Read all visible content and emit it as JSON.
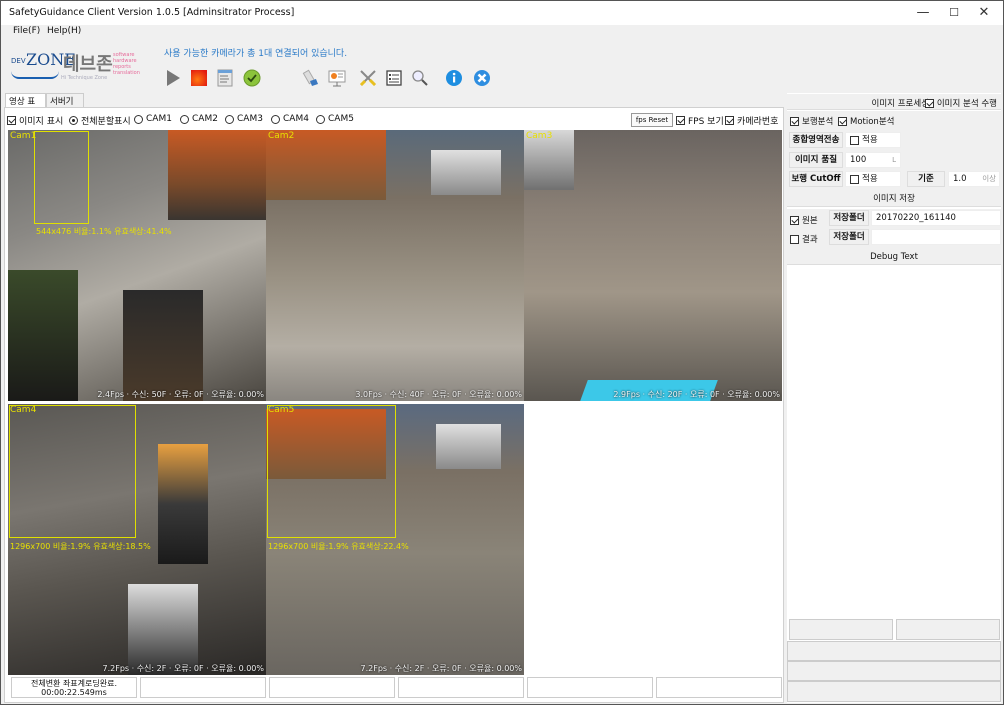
{
  "window": {
    "title": "SafetyGuidance Client Version 1.0.5 [Adminsitrator Process]",
    "minimize_glyph": "—",
    "maximize_glyph": "☐",
    "close_glyph": "✕"
  },
  "menu": {
    "file": "File(F)",
    "help": "Help(H)"
  },
  "logo": {
    "dev": "DEV",
    "zone": "ZONE",
    "korean": "데브존",
    "tagline": "Hi Technique Zone",
    "words": [
      "software",
      "hardware",
      "reports",
      "translation"
    ]
  },
  "notice": "사용 가능한 카메라가 총 1대 연결되어 있습니다.",
  "toolbar": {
    "icons": [
      "play-icon",
      "stop-icon",
      "document-list-icon",
      "checkmark-icon",
      "network-settings-icon",
      "presentation-chart-icon",
      "tools-icon",
      "form-list-icon",
      "search-icon",
      "info-icon",
      "close-circle-icon"
    ]
  },
  "tabs": [
    {
      "label": "영상 표시",
      "active": true
    },
    {
      "label": "서버기능",
      "active": false
    }
  ],
  "options": {
    "show_image": {
      "label": "이미지 표시",
      "checked": true
    },
    "view_mode": {
      "options": [
        "전체분할표시",
        "CAM1",
        "CAM2",
        "CAM3",
        "CAM4",
        "CAM5"
      ],
      "selected": "전체분할표시"
    },
    "fps_reset": "fps Reset",
    "fps_view": {
      "label": "FPS 보기",
      "checked": true
    },
    "cam_number": {
      "label": "카메라번호",
      "checked": true
    }
  },
  "cameras": [
    {
      "label": "Cam1",
      "stats": "2.4Fps  · 수신: 50F  · 오류: 0F  · 오류율: 0.00%",
      "detection": "544x476 비율:1.1% 유효색상:41.4%"
    },
    {
      "label": "Cam2",
      "stats": "3.0Fps  · 수신: 40F  · 오류: 0F  · 오류율: 0.00%",
      "detection": ""
    },
    {
      "label": "Cam3",
      "stats": "2.9Fps  · 수신: 20F  · 오류: 0F  · 오류율: 0.00%",
      "detection": ""
    },
    {
      "label": "Cam4",
      "stats": "7.2Fps  · 수신: 2F  · 오류: 0F  · 오류율: 0.00%",
      "detection": "1296x700 비율:1.9% 유효색상:18.5%"
    },
    {
      "label": "Cam5",
      "stats": "7.2Fps  · 수신: 2F  · 오류: 0F  · 오류율: 0.00%",
      "detection": "1296x700 비율:1.9% 유효색상:22.4%"
    }
  ],
  "status_cells": [
    {
      "line1": "전체변환 좌표계로딩완료.",
      "line2": "00:00:22.549ms"
    },
    {
      "line1": "",
      "line2": ""
    },
    {
      "line1": "",
      "line2": ""
    },
    {
      "line1": "",
      "line2": ""
    },
    {
      "line1": "",
      "line2": ""
    },
    {
      "line1": "",
      "line2": ""
    }
  ],
  "right_panel": {
    "image_processing": "이미지 프로세싱",
    "run_analysis": {
      "label": "이미지 분석 수행",
      "checked": true
    },
    "walk_analysis": {
      "label": "보행분석",
      "checked": true
    },
    "motion_analysis": {
      "label": "Motion분석",
      "checked": true
    },
    "combined_area": {
      "button": "종합영역전송",
      "apply_label": "적용",
      "checked": false
    },
    "image_quality": {
      "button": "이미지 품질",
      "value": "100",
      "unit": "L"
    },
    "walk_cutoff": {
      "button": "보행 CutOff",
      "apply_label": "적용",
      "checked": false,
      "criterion_button": "기준",
      "criterion_value": "1.0",
      "criterion_unit": "이상"
    },
    "image_save": "이미지 저장",
    "original": {
      "label": "원본",
      "checked": true,
      "folder_button": "저장폴더",
      "folder_value": "20170220_161140"
    },
    "result": {
      "label": "결과",
      "checked": false,
      "folder_button": "저장폴더",
      "folder_value": ""
    },
    "debug_text": "Debug Text"
  }
}
